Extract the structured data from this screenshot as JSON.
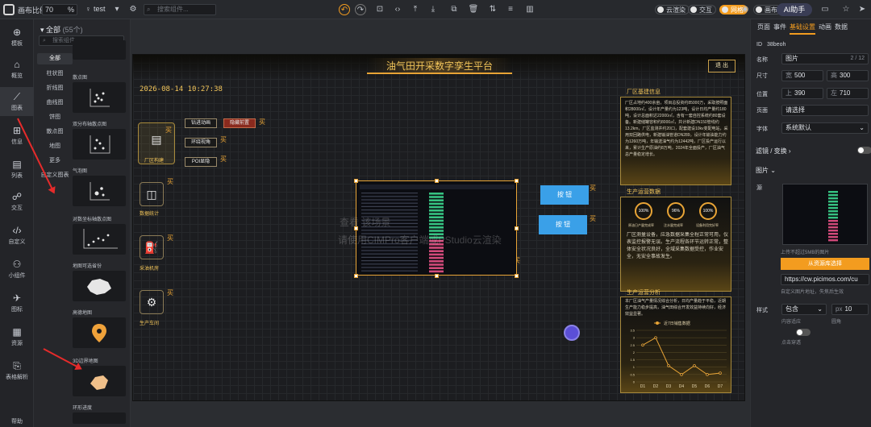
{
  "topbar": {
    "canvas_ratio_label": "画布比例",
    "ratio_value": "70",
    "ratio_unit": "%",
    "project_name": "test",
    "search_placeholder": "搜索组件...",
    "cloud_label": "云渲染",
    "interact_label": "交互",
    "mode_label": "网格",
    "canvas_label": "画布",
    "ai_label": "AI助手"
  },
  "leftnav": [
    {
      "label": "模板",
      "icon": "template-icon"
    },
    {
      "label": "概览",
      "icon": "overview-icon"
    },
    {
      "label": "图表",
      "icon": "chart-icon",
      "active": true
    },
    {
      "label": "信息",
      "icon": "info-icon"
    },
    {
      "label": "列表",
      "icon": "list-icon"
    },
    {
      "label": "交互",
      "icon": "interact-icon"
    },
    {
      "label": "自定义",
      "icon": "code-icon"
    },
    {
      "label": "小组件",
      "icon": "widget-icon"
    },
    {
      "label": "图标",
      "icon": "plane-icon"
    },
    {
      "label": "资源",
      "icon": "resource-icon"
    },
    {
      "label": "表格解析",
      "icon": "table-parse-icon"
    },
    {
      "label": "帮助",
      "icon": "help-icon"
    }
  ],
  "catalog": {
    "header": "全部",
    "count": "(55个)",
    "search_placeholder": "搜索组件...",
    "categories": [
      "全部",
      "柱状图",
      "折线图",
      "曲线图",
      "饼图",
      "散点图",
      "地图",
      "更多",
      "自定义图表"
    ],
    "thumbs": [
      "散点图",
      "双分布轴散点图",
      "气泡图",
      "对数坐标轴散点图",
      "地图可选省份",
      "高德地图",
      "3D边界地图",
      "环形进度"
    ]
  },
  "stage": {
    "title": "油气田开采数字孪生平台",
    "exit": "退 出",
    "datetime": "2026-08-14 10:27:38",
    "left_icons": [
      "厂区构建",
      "数据统计",
      "采油机房",
      "生产车间"
    ],
    "buttons": [
      "钻进动画",
      "隐藏前置",
      "环绕视角",
      "POI显隐"
    ],
    "mark": "买",
    "blue_buttons": [
      "按 钮",
      "按 钮"
    ],
    "watermark1": "查看 该场景",
    "watermark2": "请使用CIMPro客户端或PStudio云渲染",
    "panel1_title": "厂区基建信息",
    "panel1_text": "厂区占地约400余亩，项目总投资约85000万，采取按照面积28000㎡，设计年产量约为123吨，设计日均产量约180吨，设计总面积达22000㎡，含有一套自控系统约80套设备。新建储罐容积约8000㎡，共计新建DN150管线约13.2km，厂区监测井约20口，配套建设10kv变配电站，采用双回路供电，新建输油管道DN289，设计年输油能力约为1260万吨，年输送油气约为12442吨，厂区投产运行以来，累计生产原油约8万吨，2024年全面投产，厂区油气总产量稳定增长。",
    "panel2_title": "生产运营数据",
    "rings": [
      {
        "value": "100%",
        "label": "原油日产量完成率"
      },
      {
        "value": "96%",
        "label": "注水量完成率"
      },
      {
        "value": "100%",
        "label": "设备利用完好率"
      }
    ],
    "panel2_text": "厂区测量设备，应急数据采集全程正常可用，仪表监控报警无误。生产流程各环节运转正常，整体安全状况良好，全域采集数据受控，作业安全，无安全事故发生。",
    "panel3_title": "生产运营分析",
    "panel3_text": "本厂区油气产量情况综合分析，日均产量趋于平稳，近期生产能力稳步提高，油气田综合开发效益持续向好，经济效益显著。",
    "legend": "近7日销售数据"
  },
  "chart_data": {
    "type": "line",
    "categories": [
      "D1",
      "D2",
      "D3",
      "D4",
      "D5",
      "D6",
      "D7"
    ],
    "series": [
      {
        "name": "近7日销售数据",
        "values": [
          2.5,
          3,
          1.1,
          0.5,
          1.1,
          0.5,
          0.6
        ]
      }
    ],
    "ylim": [
      0,
      3.5
    ],
    "yticks": [
      "0",
      "0.5",
      "1",
      "1.5",
      "2",
      "2.5",
      "3",
      "3.5"
    ],
    "color": "#e8a436"
  },
  "props": {
    "tabs": [
      "页面",
      "事件",
      "基础设置",
      "动画",
      "数据"
    ],
    "id_label": "ID",
    "id_value": "38beoh",
    "name_label": "名称",
    "name_value": "图片",
    "name_count": "2 / 12",
    "size_label": "尺寸",
    "width_prefix": "宽",
    "width": "500",
    "height_prefix": "高",
    "height": "300",
    "pos_label": "位置",
    "top_prefix": "上",
    "top": "390",
    "left_prefix": "左",
    "left": "710",
    "page_label": "页面",
    "page_value": "请选择",
    "font_label": "字体",
    "font_value": "系统默认",
    "filter_label": "滤镜 / 变换",
    "image_section": "图片",
    "source_label": "源",
    "upload_note": "上传不超过5MB的图片",
    "from_lib": "从资源库选择",
    "url_value": "https://cw.picimos.com/cu",
    "url_note": "自定义图片地址，失焦后生效",
    "style_label": "样式",
    "fit_value": "包含",
    "fit_note": "内容适应",
    "radius_prefix": "px",
    "radius_value": "10",
    "radius_note": "圆角",
    "click_through": "点击穿透"
  }
}
